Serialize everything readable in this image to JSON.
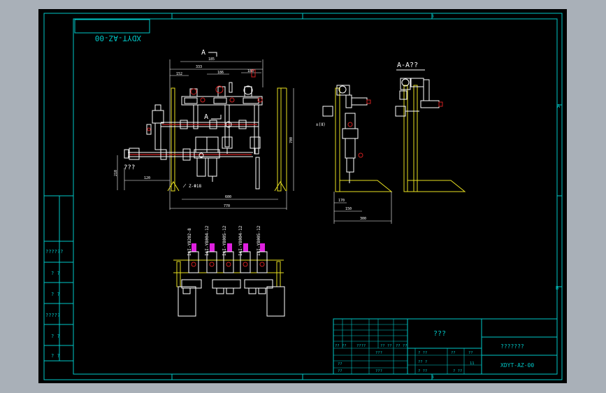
{
  "colors": {
    "background": "#000000",
    "viewport_bg": "#a9b0b8",
    "border": "#00c8c8",
    "yellow": "#e8e020",
    "white": "#ffffff",
    "red": "#d02020",
    "magenta": "#e020e0",
    "gray": "#909090"
  },
  "drawing": {
    "mirror_code": "XDYT-AZ-00",
    "section_label": "A",
    "section_title": "A-A??",
    "dims": {
      "d185": "185",
      "d333": "333",
      "d152": "152",
      "d186": "186",
      "d180": "180",
      "d600": "600",
      "d770": "770",
      "d120": "120",
      "d700": "700",
      "d210": "210",
      "d170": "170",
      "d150": "150",
      "d300": "300"
    },
    "annotations": {
      "qqq": "???",
      "pipe": "Z-Φ18",
      "side_note": "±(Ⅱ)"
    },
    "components": [
      "IAI-Y8202-8",
      "IAI-Y8004-12",
      "IAI-Y8005-12",
      "IAI-Y8004-12",
      "IAI-Y8005-12"
    ]
  },
  "frame": {
    "zone_top": "B",
    "zone_bottom": "B",
    "zone_right_top": "A",
    "zone_right_mid": "B"
  },
  "left_table": [
    "??????",
    "? ?",
    "? ?",
    "?????",
    "? ?",
    "? ?"
  ],
  "title_block": {
    "main_name": "???",
    "company": "???????",
    "drawing_no": "XDYT-AZ-00",
    "row_labels": [
      "?? ??",
      "????",
      "?? ??",
      "?? ??",
      "??",
      "???",
      "??",
      "???"
    ],
    "mid_labels": [
      "? ??",
      "??",
      "??",
      "?? ?",
      "? ??",
      "? ??",
      "11"
    ]
  }
}
